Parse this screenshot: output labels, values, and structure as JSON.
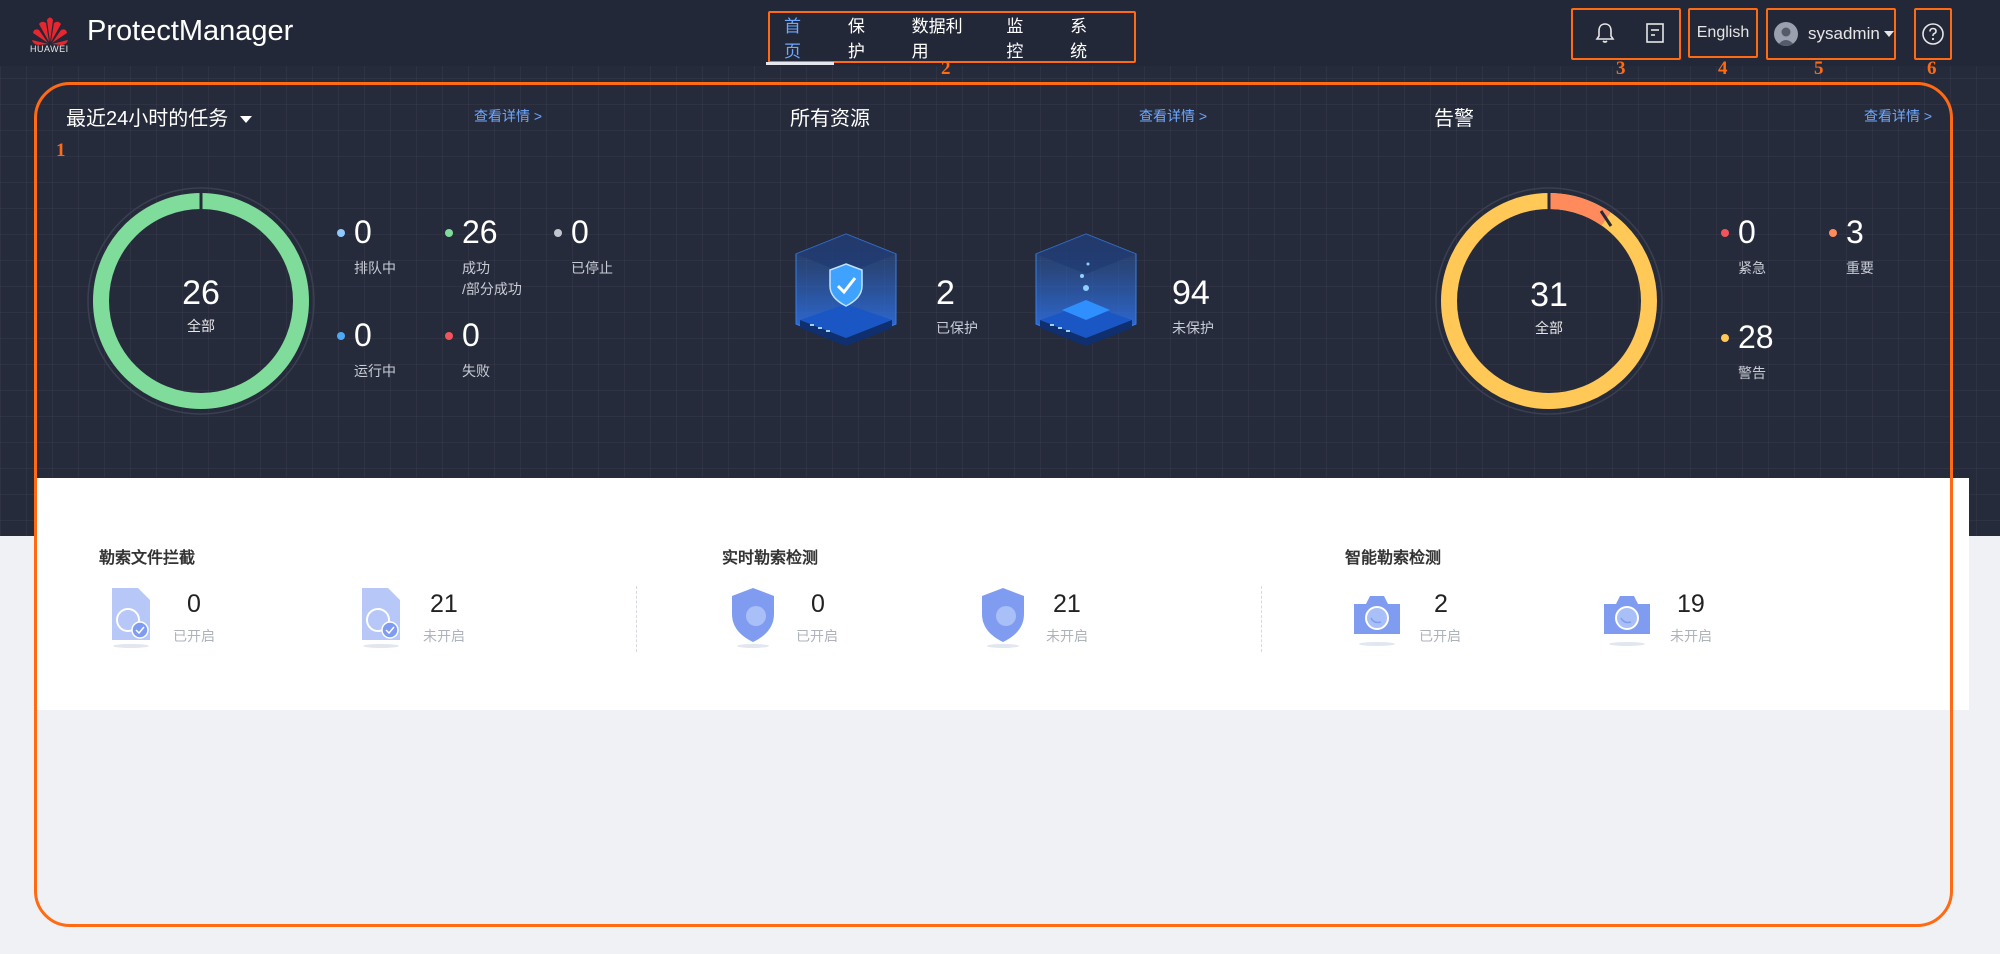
{
  "header": {
    "logo_text": "HUAWEI",
    "app_title": "ProtectManager",
    "nav": [
      "首页",
      "保护",
      "数据利用",
      "监控",
      "系统"
    ],
    "active_nav_index": 0,
    "language": "English",
    "user": "sysadmin",
    "icons": [
      "bell-icon",
      "document-icon",
      "user-avatar-icon",
      "help-icon"
    ]
  },
  "annotations": [
    "1",
    "2",
    "3",
    "4",
    "5",
    "6"
  ],
  "tasks": {
    "title": "最近24小时的任务",
    "link": "查看详情 >",
    "total": "26",
    "total_label": "全部",
    "queued": "0",
    "queued_label": "排队中",
    "success": "26",
    "success_label": "成功",
    "success_label2": "/部分成功",
    "stopped": "0",
    "stopped_label": "已停止",
    "running": "0",
    "running_label": "运行中",
    "failed": "0",
    "failed_label": "失败",
    "ring_color": "#7fdc9a"
  },
  "resources": {
    "title": "所有资源",
    "link": "查看详情 >",
    "protected": "2",
    "protected_label": "已保护",
    "unprotected": "94",
    "unprotected_label": "未保护"
  },
  "alarms": {
    "title": "告警",
    "link": "查看详情 >",
    "total": "31",
    "total_label": "全部",
    "urgent": "0",
    "urgent_label": "紧急",
    "important": "3",
    "important_label": "重要",
    "warning": "28",
    "warning_label": "警告",
    "colors": {
      "urgent": "#f2545b",
      "important": "#ff8a5b",
      "warning": "#ffc857"
    }
  },
  "ransomware": [
    {
      "title": "勒索文件拦截",
      "on": "0",
      "on_label": "已开启",
      "off": "21",
      "off_label": "未开启",
      "icon": "file-intercept-icon"
    },
    {
      "title": "实时勒索检测",
      "on": "0",
      "on_label": "已开启",
      "off": "21",
      "off_label": "未开启",
      "icon": "shield-icon"
    },
    {
      "title": "智能勒索检测",
      "on": "2",
      "on_label": "已开启",
      "off": "19",
      "off_label": "未开启",
      "icon": "camera-icon"
    }
  ]
}
